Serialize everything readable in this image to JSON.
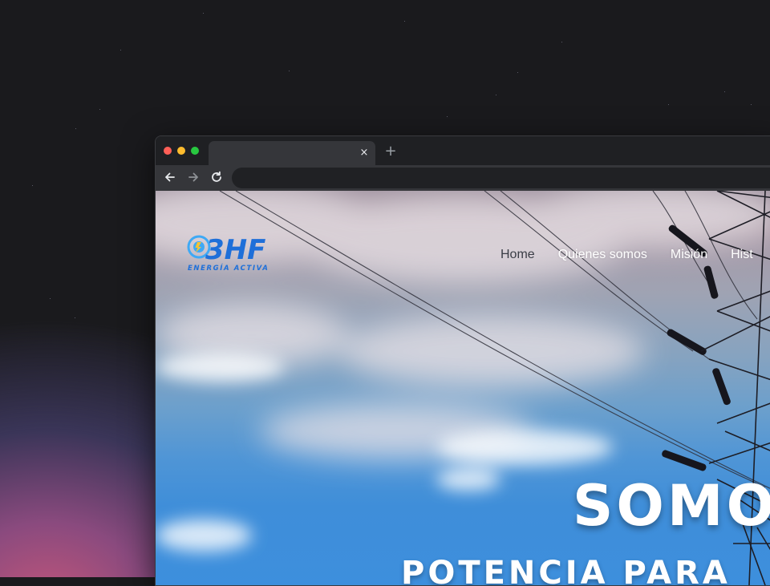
{
  "browser": {
    "tab": {
      "close_glyph": "×"
    },
    "new_tab_glyph": "+",
    "toolbar": {
      "back_icon": "arrow-left-icon",
      "forward_icon": "arrow-right-icon",
      "reload_icon": "reload-icon"
    },
    "window_controls": [
      "close",
      "minimize",
      "maximize"
    ]
  },
  "site": {
    "logo": {
      "mark": "3HF",
      "tagline": "ENERGÍA ACTIVA"
    },
    "nav": [
      {
        "label": "Home",
        "active": true
      },
      {
        "label": "Quienes somos",
        "active": false
      },
      {
        "label": "Misión",
        "active": false
      },
      {
        "label": "Hist",
        "active": false
      }
    ],
    "hero": {
      "headline": "SOMOS",
      "subheadline": "POTENCIA PARA"
    }
  },
  "colors": {
    "desktop_bg": "#1a1a1d",
    "chrome_bg": "#35363a",
    "logo_blue": "#1e6fd9",
    "logo_light_blue": "#3fa9f5",
    "nav_active": "#3a3d46",
    "hero_text": "#ffffff"
  }
}
